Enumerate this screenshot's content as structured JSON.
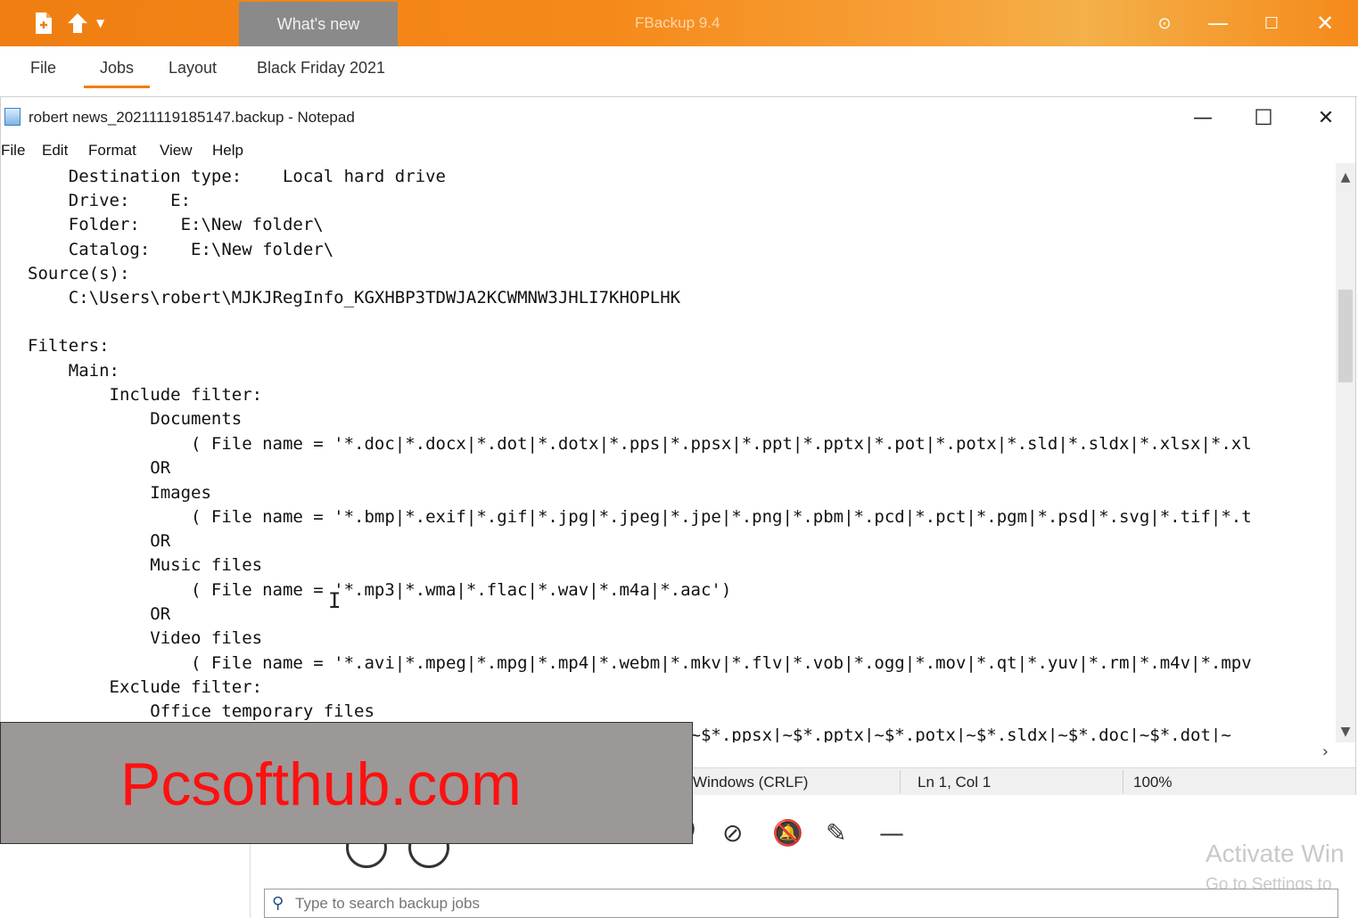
{
  "fbackup": {
    "whats_new_tab": "What's new",
    "app_title": "FBackup 9.4",
    "tabs": [
      "File",
      "Jobs",
      "Layout",
      "Black Friday 2021"
    ],
    "search_placeholder": "Type to search backup jobs",
    "activate_line1": "Activate Win",
    "activate_line2": "Go to Settings to"
  },
  "notepad": {
    "title": "robert news_20211119185147.backup - Notepad",
    "menu": [
      "File",
      "Edit",
      "Format",
      "View",
      "Help"
    ],
    "lines": [
      "    Destination type:    Local hard drive",
      "    Drive:    E:",
      "    Folder:    E:\\New folder\\",
      "    Catalog:    E:\\New folder\\",
      "Source(s):",
      "    C:\\Users\\robert\\MJKJRegInfo_KGXHBP3TDWJA2KCWMNW3JHLI7KHOPLHK",
      "",
      "Filters:",
      "    Main:",
      "        Include filter:",
      "            Documents",
      "                ( File name = '*.doc|*.docx|*.dot|*.dotx|*.pps|*.ppsx|*.ppt|*.pptx|*.pot|*.potx|*.sld|*.sldx|*.xlsx|*.xl",
      "            OR",
      "            Images",
      "                ( File name = '*.bmp|*.exif|*.gif|*.jpg|*.jpeg|*.jpe|*.png|*.pbm|*.pcd|*.pct|*.pgm|*.psd|*.svg|*.tif|*.t",
      "            OR",
      "            Music files",
      "                ( File name = '*.mp3|*.wma|*.flac|*.wav|*.m4a|*.aac')",
      "            OR",
      "            Video files",
      "                ( File name = '*.avi|*.mpeg|*.mpg|*.mp4|*.webm|*.mkv|*.flv|*.vob|*.ogg|*.mov|*.qt|*.yuv|*.rm|*.m4v|*.mpv",
      "        Exclude filter:",
      "            Office temporary files",
      "                                                            xltx|~$*.ppsx|~$*.pptx|~$*.potx|~$*.sldx|~$*.doc|~$*.dot|~"
    ],
    "status": {
      "line_ending": "Windows (CRLF)",
      "position": "Ln 1, Col 1",
      "zoom": "100%"
    }
  },
  "watermark": "Pcsofthub.com"
}
